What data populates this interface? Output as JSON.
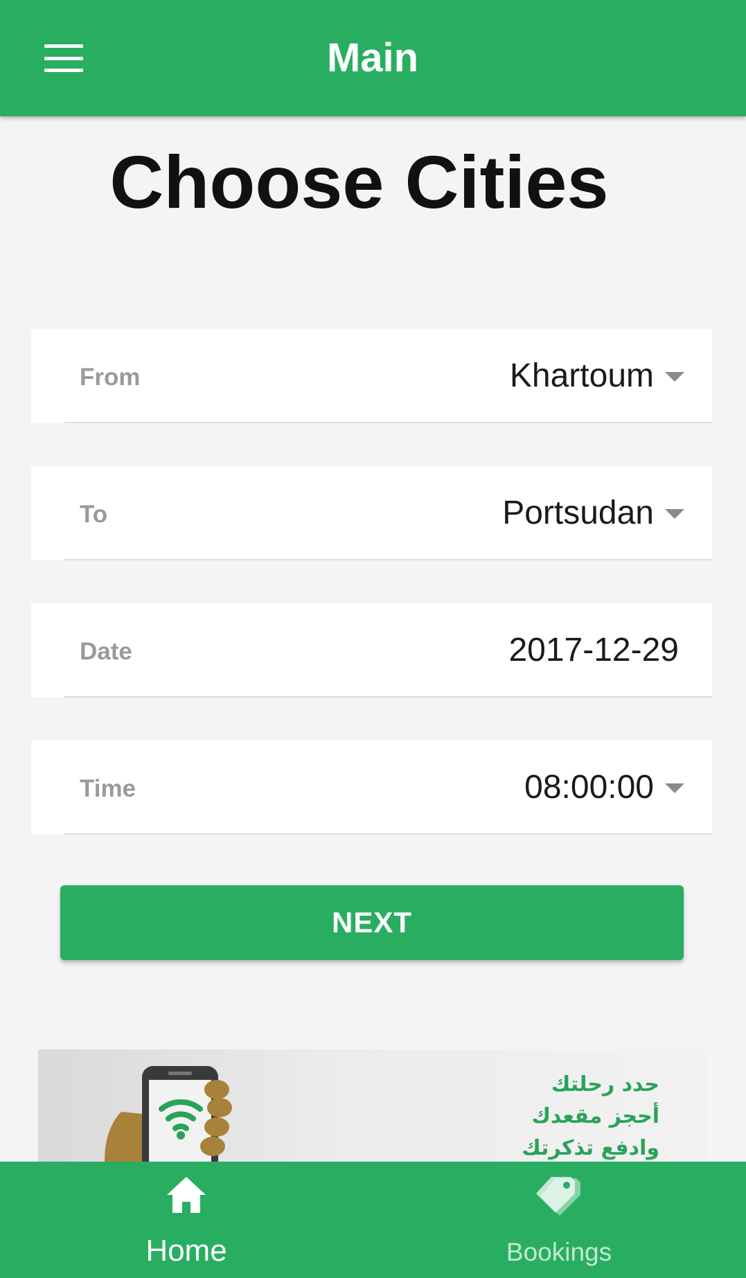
{
  "app_bar": {
    "title": "Main",
    "menu_icon": "hamburger-menu-icon",
    "background": "#29ae61"
  },
  "heading": "Choose Cities",
  "form": {
    "from": {
      "label": "From",
      "value": "Khartoum",
      "icon": "dropdown-caret-icon"
    },
    "to": {
      "label": "To",
      "value": "Portsudan",
      "icon": "dropdown-caret-icon"
    },
    "date": {
      "label": "Date",
      "value": "2017-12-29"
    },
    "time": {
      "label": "Time",
      "value": "08:00:00",
      "icon": "dropdown-caret-icon"
    }
  },
  "next_button": {
    "label": "NEXT",
    "background": "#29ae61"
  },
  "banner": {
    "lines": [
      "حدد رحلتك",
      "أحجز مقعدك",
      "وادفع تذكرتك"
    ],
    "icon": "phone-wifi-icon",
    "text_color": "#2aa35a"
  },
  "bottom_nav": {
    "items": [
      {
        "label": "Home",
        "icon": "home-icon",
        "active": true
      },
      {
        "label": "Bookings",
        "icon": "tags-icon",
        "active": false
      }
    ]
  }
}
